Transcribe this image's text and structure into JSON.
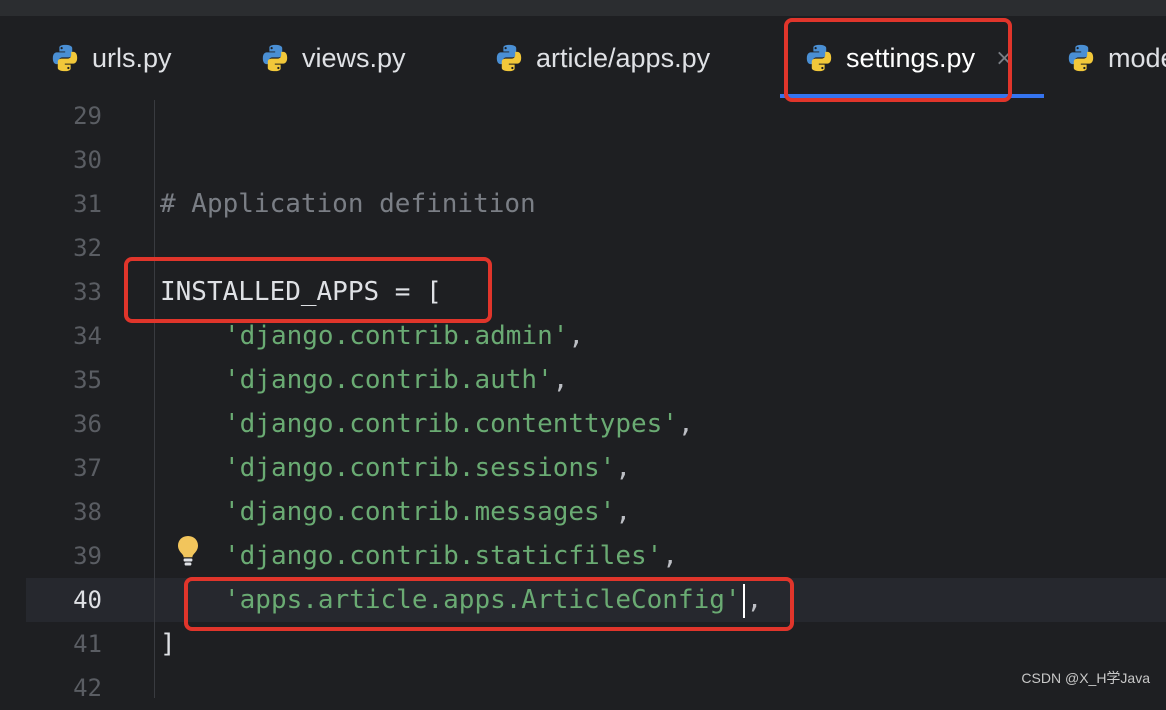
{
  "tabs": [
    {
      "label": "urls.py",
      "icon": "python-file-icon"
    },
    {
      "label": "views.py",
      "icon": "python-file-icon"
    },
    {
      "label": "article/apps.py",
      "icon": "python-file-icon"
    },
    {
      "label": "settings.py",
      "icon": "python-file-icon",
      "active": true,
      "close": "×"
    },
    {
      "label": "mode",
      "icon": "python-file-icon"
    }
  ],
  "editor": {
    "current_line": "40",
    "line_numbers": [
      "29",
      "30",
      "31",
      "32",
      "33",
      "34",
      "35",
      "36",
      "37",
      "38",
      "39",
      "40",
      "41",
      "42"
    ],
    "code": {
      "l31": "# Application definition",
      "l33": "INSTALLED_APPS = [",
      "l34_str": "'django.contrib.admin'",
      "l35_str": "'django.contrib.auth'",
      "l36_str": "'django.contrib.contenttypes'",
      "l37_str": "'django.contrib.sessions'",
      "l38_str": "'django.contrib.messages'",
      "l39_str": "'django.contrib.staticfiles'",
      "l40_str": "'apps.article.apps.ArticleConfig'",
      "comma": ",",
      "l41": "]"
    }
  },
  "intention_icon": "lightbulb-icon",
  "watermark": "CSDN @X_H学Java",
  "colors": {
    "background": "#1e1f22",
    "string": "#6aab73",
    "comment": "#7a7e85",
    "accent": "#3574f0",
    "highlight_box": "#e0352b"
  }
}
